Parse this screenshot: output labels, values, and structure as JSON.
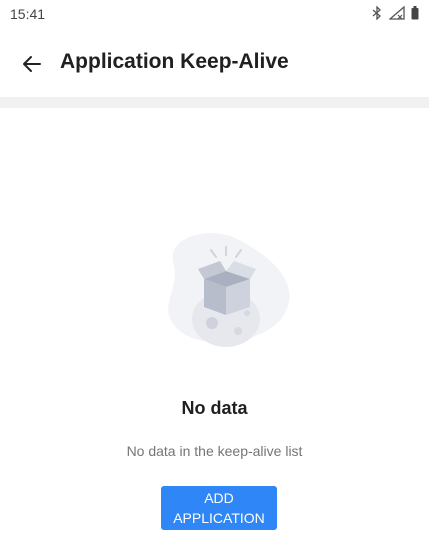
{
  "status_bar": {
    "time": "15:41",
    "icons": [
      "bluetooth-icon",
      "signal-icon",
      "battery-icon"
    ]
  },
  "header": {
    "back_icon": "back-arrow-icon",
    "title": "Application Keep-Alive"
  },
  "empty_state": {
    "illustration": "empty-box-icon",
    "title": "No data",
    "subtitle": "No data in the keep-alive list",
    "button_label": "ADD\nAPPLICATION"
  },
  "colors": {
    "accent": "#2f86f6",
    "divider": "#f1f1f1",
    "subtitle": "#757575"
  }
}
